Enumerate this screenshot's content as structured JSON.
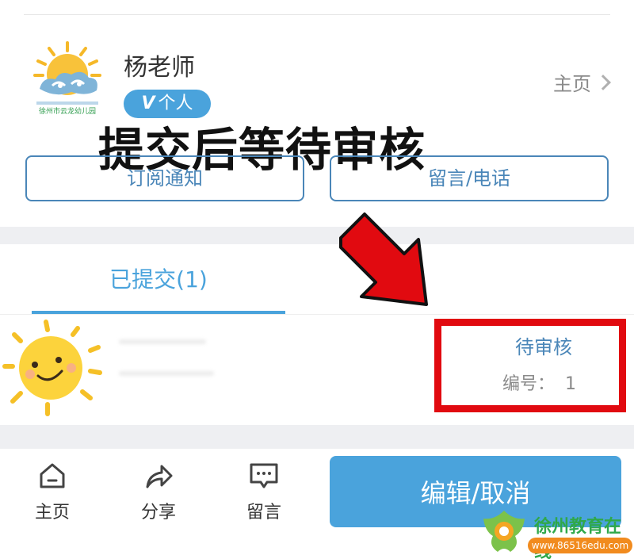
{
  "profile": {
    "name": "杨老师",
    "badge_mark": "V",
    "badge_label": "个人",
    "home_link": "主页",
    "logo_text": "徐州市云龙幼儿园"
  },
  "overlay_caption": "提交后等待审核",
  "actions": {
    "subscribe_label": "订阅通知",
    "message_label": "留言/电话"
  },
  "tabs": [
    {
      "label": "已提交(1)",
      "active": true
    }
  ],
  "submission": {
    "status": "待审核",
    "serial_label": "编号：",
    "serial_value": "1"
  },
  "bottom_nav": {
    "home_label": "主页",
    "share_label": "分享",
    "message_label": "留言",
    "primary_label": "编辑/取消"
  },
  "watermark": {
    "title": "徐州教育在线",
    "url": "www.86516edu.com"
  },
  "colors": {
    "accent": "#4aa3dc",
    "outline": "#4a86b8",
    "highlight": "#e10a10",
    "band": "#eeeff2"
  },
  "icons": [
    "home-icon",
    "share-icon",
    "message-icon",
    "chevron-right-icon",
    "arrow-pointer-icon"
  ]
}
